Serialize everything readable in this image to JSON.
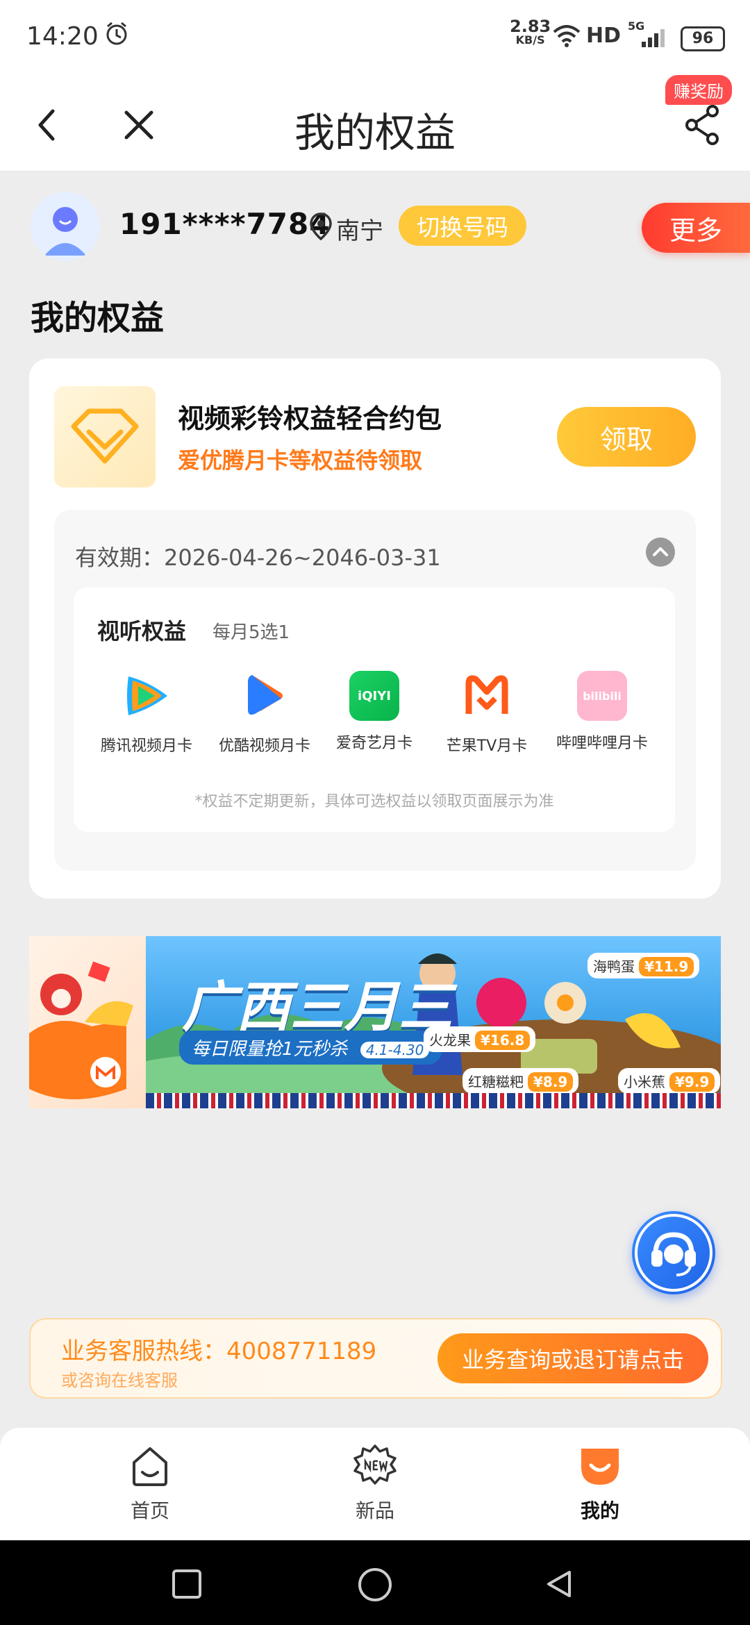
{
  "status_bar": {
    "time": "14:20",
    "net_speed": "2.83",
    "net_unit": "KB/S",
    "hd": "HD",
    "signal": "5G",
    "battery": "96"
  },
  "header": {
    "title": "我的权益",
    "reward_badge": "赚奖励"
  },
  "user": {
    "phone": "191****7784",
    "city": "南宁",
    "switch_label": "切换号码",
    "more_label": "更多"
  },
  "section_title": "我的权益",
  "package": {
    "title": "视频彩铃权益轻合约包",
    "subtitle": "爱优腾月卡等权益待领取",
    "claim_label": "领取",
    "validity": "有效期：2026-04-26~2046-03-31",
    "av_title": "视听权益",
    "av_subtitle": "每月5选1",
    "apps": [
      {
        "label": "腾讯视频月卡",
        "icon": "tencent-video-icon"
      },
      {
        "label": "优酷视频月卡",
        "icon": "youku-icon"
      },
      {
        "label": "爱奇艺月卡",
        "icon": "iqiyi-icon"
      },
      {
        "label": "芒果TV月卡",
        "icon": "mango-tv-icon"
      },
      {
        "label": "哔哩哔哩月卡",
        "icon": "bilibili-icon"
      }
    ],
    "iqiyi_text": "iQIYI",
    "bili_text": "bilibili",
    "note": "*权益不定期更新，具体可选权益以领取页面展示为准"
  },
  "banner": {
    "title": "广西三月三",
    "slogan": "每日限量抢1元秒杀",
    "date_range": "4.1-4.30",
    "items": [
      {
        "name": "海鸭蛋",
        "price": "¥11.9"
      },
      {
        "name": "火龙果",
        "price": "¥16.8"
      },
      {
        "name": "红糖糍粑",
        "price": "¥8.9"
      },
      {
        "name": "小米蕉",
        "price": "¥9.9"
      }
    ]
  },
  "hotline": {
    "text": "业务客服热线：4008771189",
    "sub": "或咨询在线客服",
    "button": "业务查询或退订请点击"
  },
  "tabs": [
    {
      "label": "首页",
      "icon": "home-icon",
      "active": false
    },
    {
      "label": "新品",
      "icon": "new-badge-icon",
      "active": false
    },
    {
      "label": "我的",
      "icon": "profile-icon",
      "active": true
    }
  ],
  "colors": {
    "accent": "#ff7a1a",
    "primary_button": "#ffb02a",
    "more_button": "#ff3b30",
    "active_tab": "#ff7a2d"
  }
}
